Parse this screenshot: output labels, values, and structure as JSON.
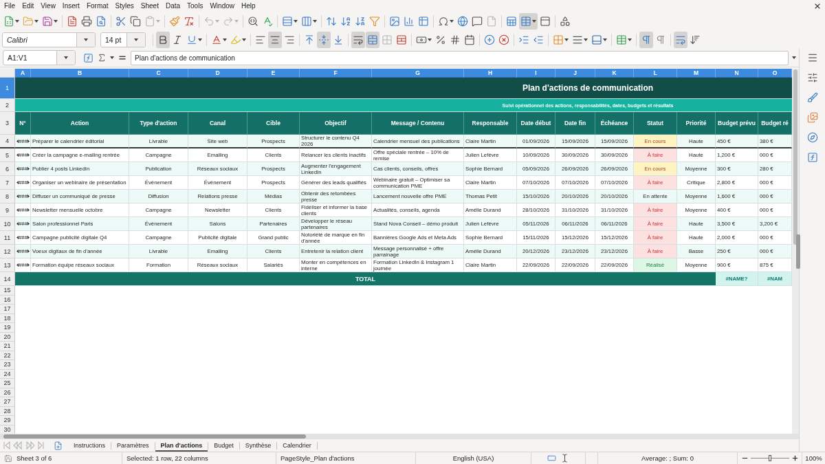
{
  "menu_bar": {
    "items": [
      "File",
      "Edit",
      "View",
      "Insert",
      "Format",
      "Styles",
      "Sheet",
      "Data",
      "Tools",
      "Window",
      "Help"
    ]
  },
  "standard_toolbar": {
    "groups": [
      [
        {
          "kind": "new",
          "pressed": false,
          "disabled": false,
          "dropdown": true
        },
        {
          "kind": "open",
          "pressed": false,
          "disabled": false,
          "dropdown": true
        },
        {
          "kind": "save",
          "pressed": false,
          "disabled": false,
          "dropdown": true
        }
      ],
      [
        {
          "kind": "pdf",
          "pressed": false,
          "disabled": false,
          "dropdown": false
        },
        {
          "kind": "print",
          "pressed": false,
          "disabled": false,
          "dropdown": false
        },
        {
          "kind": "preview",
          "pressed": false,
          "disabled": false,
          "dropdown": false
        }
      ],
      [
        {
          "kind": "cut",
          "pressed": false,
          "disabled": false,
          "dropdown": false
        },
        {
          "kind": "copy",
          "pressed": false,
          "disabled": false,
          "dropdown": false
        },
        {
          "kind": "paste",
          "pressed": false,
          "disabled": true,
          "dropdown": true
        }
      ],
      [
        {
          "kind": "clone",
          "pressed": false,
          "disabled": false,
          "dropdown": false
        },
        {
          "kind": "clear",
          "pressed": false,
          "disabled": false,
          "dropdown": false
        }
      ],
      [
        {
          "kind": "undo",
          "pressed": false,
          "disabled": true,
          "dropdown": true
        },
        {
          "kind": "redo",
          "pressed": false,
          "disabled": true,
          "dropdown": true
        }
      ],
      [
        {
          "kind": "find",
          "pressed": false,
          "disabled": false,
          "dropdown": false
        },
        {
          "kind": "spelling",
          "pressed": false,
          "disabled": false,
          "dropdown": false
        }
      ],
      [
        {
          "kind": "row",
          "pressed": false,
          "disabled": false,
          "dropdown": true
        },
        {
          "kind": "column",
          "pressed": false,
          "disabled": false,
          "dropdown": true
        }
      ],
      [
        {
          "kind": "sort",
          "pressed": false,
          "disabled": false,
          "dropdown": false
        },
        {
          "kind": "ascending",
          "pressed": false,
          "disabled": false,
          "dropdown": false
        },
        {
          "kind": "descending",
          "pressed": false,
          "disabled": false,
          "dropdown": false
        },
        {
          "kind": "autofilter",
          "pressed": false,
          "disabled": false,
          "dropdown": false
        }
      ],
      [
        {
          "kind": "image",
          "pressed": false,
          "disabled": false,
          "dropdown": false
        },
        {
          "kind": "chart",
          "pressed": false,
          "disabled": false,
          "dropdown": false
        },
        {
          "kind": "pivot",
          "pressed": false,
          "disabled": false,
          "dropdown": false
        }
      ],
      [
        {
          "kind": "symbol",
          "pressed": false,
          "disabled": false,
          "dropdown": true
        },
        {
          "kind": "hyperlink",
          "pressed": false,
          "disabled": false,
          "dropdown": false
        },
        {
          "kind": "comment",
          "pressed": false,
          "disabled": false,
          "dropdown": false
        },
        {
          "kind": "headers",
          "pressed": false,
          "disabled": true,
          "dropdown": false
        }
      ],
      [
        {
          "kind": "printarea",
          "pressed": false,
          "disabled": false,
          "dropdown": false
        },
        {
          "kind": "freeze",
          "pressed": true,
          "disabled": false,
          "dropdown": true
        },
        {
          "kind": "split",
          "pressed": false,
          "disabled": false,
          "dropdown": false
        }
      ],
      [
        {
          "kind": "shapes",
          "pressed": false,
          "disabled": false,
          "dropdown": false
        }
      ]
    ]
  },
  "formatting_toolbar": {
    "font_name": "Calibri",
    "font_size": "14 pt",
    "groups": [
      [
        {
          "kind": "bold",
          "pressed": true,
          "disabled": false,
          "dropdown": false
        },
        {
          "kind": "italic",
          "pressed": false,
          "disabled": false,
          "dropdown": false
        },
        {
          "kind": "underline",
          "pressed": false,
          "disabled": false,
          "dropdown": true
        }
      ],
      [
        {
          "kind": "fontcolor",
          "pressed": false,
          "disabled": false,
          "dropdown": true
        },
        {
          "kind": "highlight",
          "pressed": false,
          "disabled": false,
          "dropdown": true
        }
      ],
      [
        {
          "kind": "left",
          "pressed": false,
          "disabled": false,
          "dropdown": false
        },
        {
          "kind": "center",
          "pressed": true,
          "disabled": false,
          "dropdown": false
        },
        {
          "kind": "right",
          "pressed": false,
          "disabled": false,
          "dropdown": false
        }
      ],
      [
        {
          "kind": "top",
          "pressed": false,
          "disabled": false,
          "dropdown": false
        },
        {
          "kind": "middle",
          "pressed": true,
          "disabled": false,
          "dropdown": false
        },
        {
          "kind": "bottom",
          "pressed": false,
          "disabled": false,
          "dropdown": false
        }
      ],
      [
        {
          "kind": "wrap",
          "pressed": true,
          "disabled": false,
          "dropdown": false
        },
        {
          "kind": "mergecenter",
          "pressed": true,
          "disabled": false,
          "dropdown": false
        },
        {
          "kind": "merge",
          "pressed": false,
          "disabled": true,
          "dropdown": false
        },
        {
          "kind": "unmerge",
          "pressed": false,
          "disabled": false,
          "dropdown": false
        }
      ],
      [
        {
          "kind": "numberformat",
          "pressed": false,
          "disabled": false,
          "dropdown": true
        },
        {
          "kind": "percent",
          "pressed": false,
          "disabled": false,
          "dropdown": false
        },
        {
          "kind": "standard",
          "pressed": false,
          "disabled": false,
          "dropdown": false
        },
        {
          "kind": "date",
          "pressed": false,
          "disabled": false,
          "dropdown": false
        }
      ],
      [
        {
          "kind": "adddecimal",
          "pressed": false,
          "disabled": false,
          "dropdown": false
        },
        {
          "kind": "deletedecimal",
          "pressed": false,
          "disabled": false,
          "dropdown": false
        }
      ],
      [
        {
          "kind": "indent",
          "pressed": false,
          "disabled": false,
          "dropdown": false
        },
        {
          "kind": "outdent",
          "pressed": false,
          "disabled": false,
          "dropdown": false
        }
      ],
      [
        {
          "kind": "borders",
          "pressed": false,
          "disabled": false,
          "dropdown": true
        },
        {
          "kind": "borderstyle",
          "pressed": false,
          "disabled": false,
          "dropdown": true
        },
        {
          "kind": "bordercolor",
          "pressed": false,
          "disabled": false,
          "dropdown": true
        }
      ],
      [
        {
          "kind": "conditional",
          "pressed": false,
          "disabled": false,
          "dropdown": true
        }
      ],
      [
        {
          "kind": "ltr",
          "pressed": true,
          "disabled": false,
          "dropdown": false
        },
        {
          "kind": "rtl",
          "pressed": false,
          "disabled": false,
          "dropdown": false
        }
      ],
      [
        {
          "kind": "textflow",
          "pressed": true,
          "disabled": false,
          "dropdown": false
        },
        {
          "kind": "vertical",
          "pressed": false,
          "disabled": false,
          "dropdown": false
        }
      ]
    ]
  },
  "formula_bar": {
    "name_box": "A1:V1",
    "formula": "Plan d'actions de communication"
  },
  "sheet": {
    "columns": [
      {
        "label": "A",
        "selected": true
      },
      {
        "label": "B",
        "selected": true
      },
      {
        "label": "C",
        "selected": true
      },
      {
        "label": "D",
        "selected": true
      },
      {
        "label": "E",
        "selected": true
      },
      {
        "label": "F",
        "selected": true
      },
      {
        "label": "G",
        "selected": true
      },
      {
        "label": "H",
        "selected": true
      },
      {
        "label": "I",
        "selected": true
      },
      {
        "label": "J",
        "selected": true
      },
      {
        "label": "K",
        "selected": true
      },
      {
        "label": "L",
        "selected": true
      },
      {
        "label": "M",
        "selected": true
      },
      {
        "label": "N",
        "selected": true
      },
      {
        "label": "O",
        "selected": true
      }
    ],
    "title_row": {
      "number": "1",
      "selected": true,
      "text": "Plan d'actions de communication"
    },
    "subtitle_row": {
      "number": "2",
      "selected": false,
      "text": "Suivi opérationnel des actions, responsabilités, dates, budgets et résultats"
    },
    "header_row": {
      "number": "3",
      "selected": false,
      "cells": [
        "N°",
        "Action",
        "Type d'action",
        "Canal",
        "Cible",
        "Objectif",
        "Message / Contenu",
        "Responsable",
        "Date début",
        "Date fin",
        "Échéance",
        "Statut",
        "Priorité",
        "Budget prévu",
        "Budget ré"
      ]
    },
    "rows": [
      {
        "number": "4",
        "selected": false,
        "freeze_line": true,
        "no": "###",
        "action": "Préparer le calendrier éditorial",
        "type": "Livrable",
        "channel": "Site web",
        "target": "Prospects",
        "objective": "Structurer le contenu Q4 2026",
        "message": "Calendrier mensuel des publications",
        "owner": "Claire Martin",
        "start": "01/09/2026",
        "end": "15/09/2026",
        "due": "15/09/2026",
        "status": {
          "text": "En cours",
          "kind": "progress"
        },
        "priority": "Haute",
        "budget_planned": "450 €",
        "budget_actual": "380 €"
      },
      {
        "number": "5",
        "selected": false,
        "freeze_line": false,
        "no": "###",
        "action": "Créer la campagne e-mailing rentrée",
        "type": "Campagne",
        "channel": "Emailing",
        "target": "Clients",
        "objective": "Relancer les clients inactifs",
        "message": "Offre spéciale rentrée – 10% de remise",
        "owner": "Julien Lefèvre",
        "start": "10/09/2026",
        "end": "30/09/2026",
        "due": "30/09/2026",
        "status": {
          "text": "À faire",
          "kind": "todo"
        },
        "priority": "Haute",
        "budget_planned": "1,200 €",
        "budget_actual": "000 €"
      },
      {
        "number": "6",
        "selected": false,
        "freeze_line": false,
        "no": "###",
        "action": "Publier 4 posts LinkedIn",
        "type": "Publication",
        "channel": "Réseaux sociaux",
        "target": "Prospects",
        "objective": "Augmenter l'engagement LinkedIn",
        "message": "Cas clients, conseils, offres",
        "owner": "Sophie Bernard",
        "start": "05/09/2026",
        "end": "26/09/2026",
        "due": "26/09/2026",
        "status": {
          "text": "En cours",
          "kind": "progress"
        },
        "priority": "Moyenne",
        "budget_planned": "300 €",
        "budget_actual": "280 €"
      },
      {
        "number": "7",
        "selected": false,
        "freeze_line": false,
        "no": "###",
        "action": "Organiser un webinaire de présentation",
        "type": "Événement",
        "channel": "Événement",
        "target": "Prospects",
        "objective": "Générer des leads qualifiés",
        "message": "Webinaire gratuit – Optimiser sa communication PME",
        "owner": "Claire Martin",
        "start": "07/10/2026",
        "end": "07/10/2026",
        "due": "07/10/2026",
        "status": {
          "text": "À faire",
          "kind": "todo"
        },
        "priority": "Critique",
        "budget_planned": "2,800 €",
        "budget_actual": "000 €"
      },
      {
        "number": "8",
        "selected": false,
        "freeze_line": false,
        "no": "###",
        "action": "Diffuser un communiqué de presse",
        "type": "Diffusion",
        "channel": "Relations presse",
        "target": "Médias",
        "objective": "Obtenir des retombées presse",
        "message": "Lancement nouvelle offre PME",
        "owner": "Thomas Petit",
        "start": "15/10/2026",
        "end": "20/10/2026",
        "due": "20/10/2026",
        "status": {
          "text": "En attente",
          "kind": "waiting"
        },
        "priority": "Moyenne",
        "budget_planned": "1,600 €",
        "budget_actual": "000 €"
      },
      {
        "number": "9",
        "selected": false,
        "freeze_line": false,
        "no": "###",
        "action": "Newsletter mensuelle octobre",
        "type": "Campagne",
        "channel": "Newsletter",
        "target": "Clients",
        "objective": "Fidéliser et informer la base clients",
        "message": "Actualités, conseils, agenda",
        "owner": "Amélie Durand",
        "start": "28/10/2026",
        "end": "31/10/2026",
        "due": "31/10/2026",
        "status": {
          "text": "À faire",
          "kind": "todo"
        },
        "priority": "Moyenne",
        "budget_planned": "400 €",
        "budget_actual": "000 €"
      },
      {
        "number": "10",
        "selected": false,
        "freeze_line": false,
        "no": "###",
        "action": "Salon professionnel Paris",
        "type": "Événement",
        "channel": "Salons",
        "target": "Partenaires",
        "objective": "Développer le réseau partenaires",
        "message": "Stand Nova Conseil – démo produit",
        "owner": "Julien Lefèvre",
        "start": "05/11/2026",
        "end": "06/11/2026",
        "due": "06/11/2026",
        "status": {
          "text": "À faire",
          "kind": "todo"
        },
        "priority": "Haute",
        "budget_planned": "3,500 €",
        "budget_actual": "3,200 €"
      },
      {
        "number": "11",
        "selected": false,
        "freeze_line": false,
        "no": "###",
        "action": "Campagne publicité digitale Q4",
        "type": "Campagne",
        "channel": "Publicité digitale",
        "target": "Grand public",
        "objective": "Notoriété de marque en fin d'année",
        "message": "Bannières Google Ads et Meta Ads",
        "owner": "Sophie Bernard",
        "start": "15/11/2026",
        "end": "15/12/2026",
        "due": "15/12/2026",
        "status": {
          "text": "À faire",
          "kind": "todo"
        },
        "priority": "Haute",
        "budget_planned": "2,000 €",
        "budget_actual": "000 €"
      },
      {
        "number": "12",
        "selected": false,
        "freeze_line": false,
        "no": "###",
        "action": "Voeux digitaux de fin d'année",
        "type": "Livrable",
        "channel": "Emailing",
        "target": "Clients",
        "objective": "Entretenir la relation client",
        "message": "Message personnalisé + offre parrainage",
        "owner": "Amélie Durand",
        "start": "20/12/2026",
        "end": "23/12/2026",
        "due": "23/12/2026",
        "status": {
          "text": "À faire",
          "kind": "todo"
        },
        "priority": "Basse",
        "budget_planned": "250 €",
        "budget_actual": "000 €"
      },
      {
        "number": "13",
        "selected": false,
        "freeze_line": false,
        "no": "###",
        "action": "Formation équipe réseaux sociaux",
        "type": "Formation",
        "channel": "Réseaux sociaux",
        "target": "Salariés",
        "objective": "Monter en compétences en interne",
        "message": "Formation LinkedIn & Instagram 1 journée",
        "owner": "Claire Martin",
        "start": "22/09/2026",
        "end": "22/09/2026",
        "due": "22/09/2026",
        "status": {
          "text": "Réalisé",
          "kind": "done"
        },
        "priority": "Moyenne",
        "budget_planned": "900 €",
        "budget_actual": "875 €"
      }
    ],
    "total_row": {
      "number": "14",
      "selected": false,
      "label": "TOTAL",
      "budget_planned": "#NAME?",
      "budget_actual": "#NAM"
    },
    "empty_rows": [
      {
        "number": "15",
        "selected": false
      },
      {
        "number": "16",
        "selected": false
      },
      {
        "number": "17",
        "selected": false
      },
      {
        "number": "18",
        "selected": false
      },
      {
        "number": "19",
        "selected": false
      },
      {
        "number": "20",
        "selected": false
      },
      {
        "number": "21",
        "selected": false
      },
      {
        "number": "22",
        "selected": false
      },
      {
        "number": "23",
        "selected": false
      },
      {
        "number": "24",
        "selected": false
      },
      {
        "number": "25",
        "selected": false
      },
      {
        "number": "26",
        "selected": false
      },
      {
        "number": "27",
        "selected": false
      },
      {
        "number": "28",
        "selected": false
      },
      {
        "number": "29",
        "selected": false
      },
      {
        "number": "30",
        "selected": false
      }
    ]
  },
  "sheet_tabs": {
    "tabs": [
      {
        "label": "Instructions",
        "selected": false
      },
      {
        "label": "Paramètres",
        "selected": false
      },
      {
        "label": "Plan d'actions",
        "selected": true
      },
      {
        "label": "Budget",
        "selected": false
      },
      {
        "label": "Synthèse",
        "selected": false
      },
      {
        "label": "Calendrier",
        "selected": false
      }
    ]
  },
  "status_bar": {
    "sheet": "Sheet 3 of 6",
    "selection": "Selected: 1 row, 22 columns",
    "page_style": "PageStyle_Plan d'actions",
    "language": "English (USA)",
    "summary": "Average: ; Sum: 0",
    "zoom": {
      "level": 0.5,
      "reading": "100%"
    }
  }
}
